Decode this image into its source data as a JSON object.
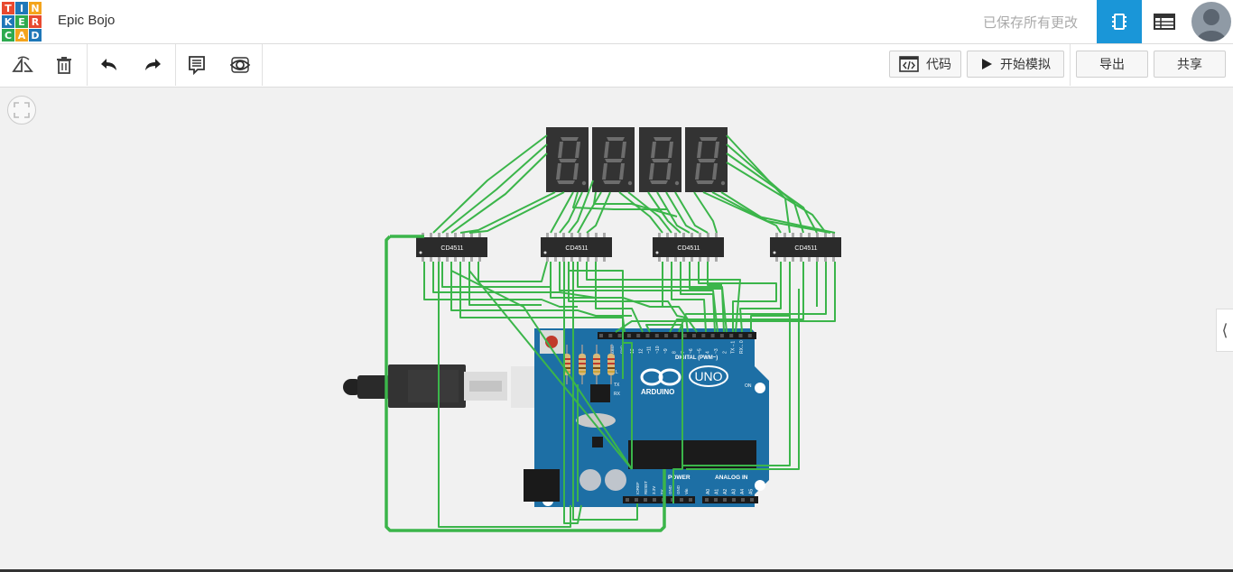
{
  "header": {
    "logo_letters": [
      "T",
      "I",
      "N",
      "K",
      "E",
      "R",
      "C",
      "A",
      "D"
    ],
    "logo_colors": [
      "#e8492f",
      "#1e77b8",
      "#f4a41c",
      "#1e77b8",
      "#2eaa4f",
      "#e8492f",
      "#2eaa4f",
      "#f4a41c",
      "#1e77b8"
    ],
    "project_title": "Epic Bojo",
    "save_status": "已保存所有更改",
    "accent_color": "#1a96d8",
    "icons": [
      "circuit-view-icon",
      "list-view-icon",
      "user-avatar"
    ]
  },
  "toolbar": {
    "tools": [
      "rotate-icon",
      "delete-icon",
      "undo-icon",
      "redo-icon",
      "notes-icon",
      "visibility-icon"
    ],
    "code_label": "代码",
    "simulate_label": "开始模拟",
    "export_label": "导出",
    "share_label": "共享"
  },
  "canvas": {
    "chip_labels": [
      "CD4511",
      "CD4511",
      "CD4511",
      "CD4511"
    ],
    "board": {
      "brand": "ARDUINO",
      "model": "UNO",
      "digital_label": "DIGITAL (PWM~)",
      "power_label": "POWER",
      "analog_label": "ANALOG IN",
      "aref": "AREF",
      "gnd": "GND",
      "tx": "TX",
      "rx": "RX",
      "on": "ON",
      "l_label": "L",
      "digital_pins": [
        "13",
        "12",
        "~11",
        "~10",
        "~9",
        "8",
        "7",
        "~6",
        "~5",
        "4",
        "~3",
        "2",
        "TX→1",
        "RX←0"
      ],
      "power_pins": [
        "IOREF",
        "RESET",
        "3.3V",
        "5V",
        "GND",
        "GND",
        "Vin"
      ],
      "analog_pins": [
        "A0",
        "A1",
        "A2",
        "A3",
        "A4",
        "A5"
      ]
    },
    "wire_color": "#3bb54a",
    "side_tab_glyph": "⟨"
  }
}
